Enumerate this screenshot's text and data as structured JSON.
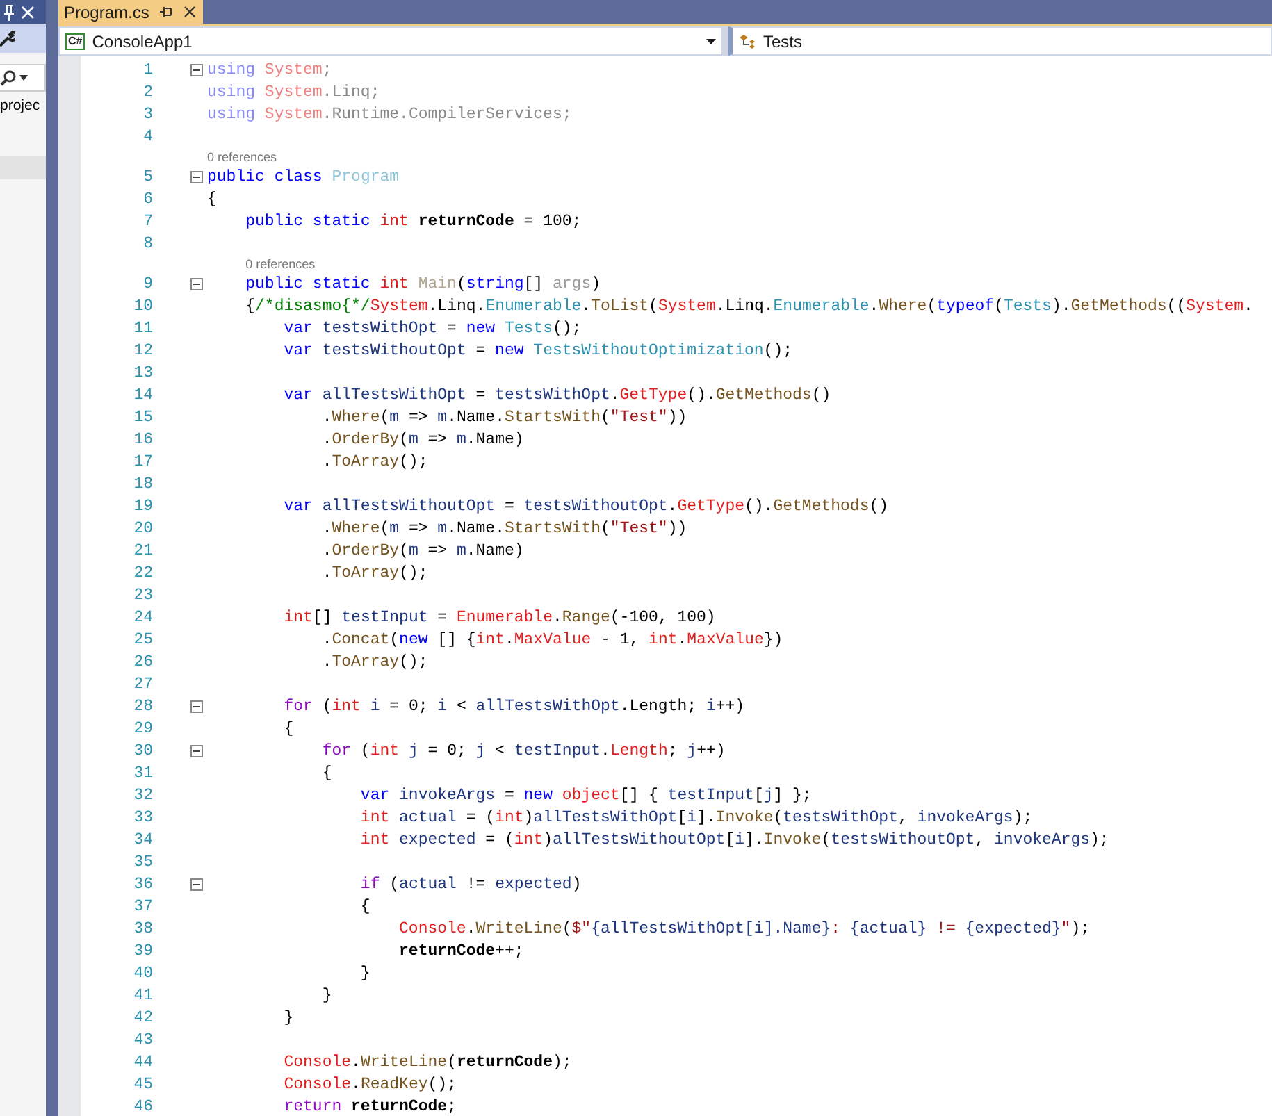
{
  "side_panel": {
    "label": "projec"
  },
  "tabs": [
    {
      "label": "Program.cs",
      "selected": true
    }
  ],
  "nav": {
    "project_badge": "C#",
    "project": "ConsoleApp1",
    "member": "Tests"
  },
  "lines": [
    {
      "kind": "code",
      "n": "1",
      "fold": true,
      "t": [
        {
          "kind": "u",
          "text": "using"
        },
        {
          "kind": "ns",
          "text": " System"
        },
        {
          "kind": "f",
          "text": ";"
        }
      ]
    },
    {
      "kind": "code",
      "n": "2",
      "fold": false,
      "t": [
        {
          "kind": "u",
          "text": "using"
        },
        {
          "kind": "ns",
          "text": " System"
        },
        {
          "kind": "f",
          "text": ".Linq;"
        }
      ]
    },
    {
      "kind": "code",
      "n": "3",
      "fold": false,
      "t": [
        {
          "kind": "u",
          "text": "using"
        },
        {
          "kind": "ns",
          "text": " System"
        },
        {
          "kind": "f",
          "text": ".Runtime.CompilerServices;"
        }
      ]
    },
    {
      "kind": "code",
      "n": "4",
      "fold": false
    },
    {
      "kind": "lens",
      "text": "0 references"
    },
    {
      "kind": "code",
      "n": "5",
      "fold": true,
      "t": [
        {
          "kind": "kw",
          "text": "public"
        },
        {
          "kind": "kw",
          "text": " class"
        },
        {
          "kind": "cf",
          "text": " Program"
        }
      ]
    },
    {
      "kind": "code",
      "n": "6",
      "fold": false,
      "t": [
        {
          "kind": "p",
          "text": "{"
        }
      ]
    },
    {
      "kind": "code",
      "n": "7",
      "fold": false,
      "t": [
        {
          "kind": "kw",
          "text": "    public"
        },
        {
          "kind": "kw",
          "text": " static"
        },
        {
          "kind": "ty",
          "text": " int"
        },
        {
          "kind": "fld",
          "text": " returnCode"
        },
        {
          "kind": "p",
          "text": " = 100;"
        }
      ]
    },
    {
      "kind": "code",
      "n": "8",
      "fold": false
    },
    {
      "kind": "lens",
      "text": "0 references"
    },
    {
      "kind": "code",
      "n": "9",
      "fold": true,
      "t": [
        {
          "kind": "kw",
          "text": "    public"
        },
        {
          "kind": "kw",
          "text": " static"
        },
        {
          "kind": "ty",
          "text": " int"
        },
        {
          "kind": "ff",
          "text": " Main"
        },
        {
          "kind": "p",
          "text": "("
        },
        {
          "kind": "kw",
          "text": "string"
        },
        {
          "kind": "p",
          "text": "[]"
        },
        {
          "kind": "un",
          "text": " args"
        },
        {
          "kind": "p",
          "text": ")"
        }
      ]
    },
    {
      "kind": "code",
      "n": "10",
      "fold": false,
      "t": [
        {
          "kind": "p",
          "text": "    {"
        },
        {
          "kind": "com",
          "text": "/*disasmo{*/"
        },
        {
          "kind": "ty",
          "text": "System"
        },
        {
          "kind": "p",
          "text": ".Linq."
        },
        {
          "kind": "cls",
          "text": "Enumerable"
        },
        {
          "kind": "p",
          "text": "."
        },
        {
          "kind": "fn",
          "text": "ToList"
        },
        {
          "kind": "p",
          "text": "("
        },
        {
          "kind": "ty",
          "text": "System"
        },
        {
          "kind": "p",
          "text": ".Linq."
        },
        {
          "kind": "cls",
          "text": "Enumerable"
        },
        {
          "kind": "p",
          "text": "."
        },
        {
          "kind": "fn",
          "text": "Where"
        },
        {
          "kind": "p",
          "text": "("
        },
        {
          "kind": "kw",
          "text": "typeof"
        },
        {
          "kind": "p",
          "text": "("
        },
        {
          "kind": "cls",
          "text": "Tests"
        },
        {
          "kind": "p",
          "text": ")."
        },
        {
          "kind": "fn",
          "text": "GetMethods"
        },
        {
          "kind": "p",
          "text": "(("
        },
        {
          "kind": "ty",
          "text": "System"
        },
        {
          "kind": "p",
          "text": "."
        }
      ]
    },
    {
      "kind": "code",
      "n": "11",
      "fold": false,
      "t": [
        {
          "kind": "kw",
          "text": "        var"
        },
        {
          "kind": "id",
          "text": " testsWithOpt"
        },
        {
          "kind": "p",
          "text": " ="
        },
        {
          "kind": "kw",
          "text": " new"
        },
        {
          "kind": "cls",
          "text": " Tests"
        },
        {
          "kind": "p",
          "text": "();"
        }
      ]
    },
    {
      "kind": "code",
      "n": "12",
      "fold": false,
      "t": [
        {
          "kind": "kw",
          "text": "        var"
        },
        {
          "kind": "id",
          "text": " testsWithoutOpt"
        },
        {
          "kind": "p",
          "text": " ="
        },
        {
          "kind": "kw",
          "text": " new"
        },
        {
          "kind": "cls",
          "text": " TestsWithoutOptimization"
        },
        {
          "kind": "p",
          "text": "();"
        }
      ]
    },
    {
      "kind": "code",
      "n": "13",
      "fold": false
    },
    {
      "kind": "code",
      "n": "14",
      "fold": false,
      "t": [
        {
          "kind": "kw",
          "text": "        var"
        },
        {
          "kind": "id",
          "text": " allTestsWithOpt"
        },
        {
          "kind": "p",
          "text": " ="
        },
        {
          "kind": "id",
          "text": " testsWithOpt"
        },
        {
          "kind": "p",
          "text": "."
        },
        {
          "kind": "ty",
          "text": "GetType"
        },
        {
          "kind": "p",
          "text": "()."
        },
        {
          "kind": "fn",
          "text": "GetMethods"
        },
        {
          "kind": "p",
          "text": "()"
        }
      ]
    },
    {
      "kind": "code",
      "n": "15",
      "fold": false,
      "t": [
        {
          "kind": "p",
          "text": "            ."
        },
        {
          "kind": "fn",
          "text": "Where"
        },
        {
          "kind": "p",
          "text": "("
        },
        {
          "kind": "id",
          "text": "m"
        },
        {
          "kind": "p",
          "text": " =>"
        },
        {
          "kind": "id",
          "text": " m"
        },
        {
          "kind": "p",
          "text": ".Name."
        },
        {
          "kind": "fn",
          "text": "StartsWith"
        },
        {
          "kind": "p",
          "text": "("
        },
        {
          "kind": "str",
          "text": "\"Test\""
        },
        {
          "kind": "p",
          "text": "))"
        }
      ]
    },
    {
      "kind": "code",
      "n": "16",
      "fold": false,
      "t": [
        {
          "kind": "p",
          "text": "            ."
        },
        {
          "kind": "fn",
          "text": "OrderBy"
        },
        {
          "kind": "p",
          "text": "("
        },
        {
          "kind": "id",
          "text": "m"
        },
        {
          "kind": "p",
          "text": " =>"
        },
        {
          "kind": "id",
          "text": " m"
        },
        {
          "kind": "p",
          "text": ".Name)"
        }
      ]
    },
    {
      "kind": "code",
      "n": "17",
      "fold": false,
      "t": [
        {
          "kind": "p",
          "text": "            ."
        },
        {
          "kind": "fn",
          "text": "ToArray"
        },
        {
          "kind": "p",
          "text": "();"
        }
      ]
    },
    {
      "kind": "code",
      "n": "18",
      "fold": false
    },
    {
      "kind": "code",
      "n": "19",
      "fold": false,
      "t": [
        {
          "kind": "kw",
          "text": "        var"
        },
        {
          "kind": "id",
          "text": " allTestsWithoutOpt"
        },
        {
          "kind": "p",
          "text": " ="
        },
        {
          "kind": "id",
          "text": " testsWithoutOpt"
        },
        {
          "kind": "p",
          "text": "."
        },
        {
          "kind": "ty",
          "text": "GetType"
        },
        {
          "kind": "p",
          "text": "()."
        },
        {
          "kind": "fn",
          "text": "GetMethods"
        },
        {
          "kind": "p",
          "text": "()"
        }
      ]
    },
    {
      "kind": "code",
      "n": "20",
      "fold": false,
      "t": [
        {
          "kind": "p",
          "text": "            ."
        },
        {
          "kind": "fn",
          "text": "Where"
        },
        {
          "kind": "p",
          "text": "("
        },
        {
          "kind": "id",
          "text": "m"
        },
        {
          "kind": "p",
          "text": " =>"
        },
        {
          "kind": "id",
          "text": " m"
        },
        {
          "kind": "p",
          "text": ".Name."
        },
        {
          "kind": "fn",
          "text": "StartsWith"
        },
        {
          "kind": "p",
          "text": "("
        },
        {
          "kind": "str",
          "text": "\"Test\""
        },
        {
          "kind": "p",
          "text": "))"
        }
      ]
    },
    {
      "kind": "code",
      "n": "21",
      "fold": false,
      "t": [
        {
          "kind": "p",
          "text": "            ."
        },
        {
          "kind": "fn",
          "text": "OrderBy"
        },
        {
          "kind": "p",
          "text": "("
        },
        {
          "kind": "id",
          "text": "m"
        },
        {
          "kind": "p",
          "text": " =>"
        },
        {
          "kind": "id",
          "text": " m"
        },
        {
          "kind": "p",
          "text": ".Name)"
        }
      ]
    },
    {
      "kind": "code",
      "n": "22",
      "fold": false,
      "t": [
        {
          "kind": "p",
          "text": "            ."
        },
        {
          "kind": "fn",
          "text": "ToArray"
        },
        {
          "kind": "p",
          "text": "();"
        }
      ]
    },
    {
      "kind": "code",
      "n": "23",
      "fold": false
    },
    {
      "kind": "code",
      "n": "24",
      "fold": false,
      "t": [
        {
          "kind": "ty",
          "text": "        int"
        },
        {
          "kind": "p",
          "text": "[]"
        },
        {
          "kind": "id",
          "text": " testInput"
        },
        {
          "kind": "p",
          "text": " ="
        },
        {
          "kind": "ty",
          "text": " Enumerable"
        },
        {
          "kind": "p",
          "text": "."
        },
        {
          "kind": "fn",
          "text": "Range"
        },
        {
          "kind": "p",
          "text": "(-100, 100)"
        }
      ]
    },
    {
      "kind": "code",
      "n": "25",
      "fold": false,
      "t": [
        {
          "kind": "p",
          "text": "            ."
        },
        {
          "kind": "fn",
          "text": "Concat"
        },
        {
          "kind": "p",
          "text": "("
        },
        {
          "kind": "kw",
          "text": "new"
        },
        {
          "kind": "p",
          "text": " [] {"
        },
        {
          "kind": "ty",
          "text": "int"
        },
        {
          "kind": "p",
          "text": "."
        },
        {
          "kind": "ty",
          "text": "MaxValue"
        },
        {
          "kind": "p",
          "text": " - 1,"
        },
        {
          "kind": "ty",
          "text": " int"
        },
        {
          "kind": "p",
          "text": "."
        },
        {
          "kind": "ty",
          "text": "MaxValue"
        },
        {
          "kind": "p",
          "text": "})"
        }
      ]
    },
    {
      "kind": "code",
      "n": "26",
      "fold": false,
      "t": [
        {
          "kind": "p",
          "text": "            ."
        },
        {
          "kind": "fn",
          "text": "ToArray"
        },
        {
          "kind": "p",
          "text": "();"
        }
      ]
    },
    {
      "kind": "code",
      "n": "27",
      "fold": false
    },
    {
      "kind": "code",
      "n": "28",
      "fold": true,
      "t": [
        {
          "kind": "ctl",
          "text": "        for"
        },
        {
          "kind": "p",
          "text": " ("
        },
        {
          "kind": "ty",
          "text": "int"
        },
        {
          "kind": "id",
          "text": " i"
        },
        {
          "kind": "p",
          "text": " = 0;"
        },
        {
          "kind": "id",
          "text": " i"
        },
        {
          "kind": "p",
          "text": " <"
        },
        {
          "kind": "id",
          "text": " allTestsWithOpt"
        },
        {
          "kind": "p",
          "text": ".Length;"
        },
        {
          "kind": "id",
          "text": " i"
        },
        {
          "kind": "p",
          "text": "++)"
        }
      ]
    },
    {
      "kind": "code",
      "n": "29",
      "fold": false,
      "t": [
        {
          "kind": "p",
          "text": "        {"
        }
      ]
    },
    {
      "kind": "code",
      "n": "30",
      "fold": true,
      "t": [
        {
          "kind": "ctl",
          "text": "            for"
        },
        {
          "kind": "p",
          "text": " ("
        },
        {
          "kind": "ty",
          "text": "int"
        },
        {
          "kind": "id",
          "text": " j"
        },
        {
          "kind": "p",
          "text": " = 0;"
        },
        {
          "kind": "id",
          "text": " j"
        },
        {
          "kind": "p",
          "text": " <"
        },
        {
          "kind": "id",
          "text": " testInput"
        },
        {
          "kind": "p",
          "text": "."
        },
        {
          "kind": "ty",
          "text": "Length"
        },
        {
          "kind": "p",
          "text": ";"
        },
        {
          "kind": "id",
          "text": " j"
        },
        {
          "kind": "p",
          "text": "++)"
        }
      ]
    },
    {
      "kind": "code",
      "n": "31",
      "fold": false,
      "t": [
        {
          "kind": "p",
          "text": "            {"
        }
      ]
    },
    {
      "kind": "code",
      "n": "32",
      "fold": false,
      "t": [
        {
          "kind": "kw",
          "text": "                var"
        },
        {
          "kind": "id",
          "text": " invokeArgs"
        },
        {
          "kind": "p",
          "text": " ="
        },
        {
          "kind": "kw",
          "text": " new"
        },
        {
          "kind": "ty",
          "text": " object"
        },
        {
          "kind": "p",
          "text": "[] {"
        },
        {
          "kind": "id",
          "text": " testInput"
        },
        {
          "kind": "p",
          "text": "["
        },
        {
          "kind": "id",
          "text": "j"
        },
        {
          "kind": "p",
          "text": "] };"
        }
      ]
    },
    {
      "kind": "code",
      "n": "33",
      "fold": false,
      "t": [
        {
          "kind": "ty",
          "text": "                int"
        },
        {
          "kind": "id",
          "text": " actual"
        },
        {
          "kind": "p",
          "text": " = ("
        },
        {
          "kind": "ty",
          "text": "int"
        },
        {
          "kind": "p",
          "text": ")"
        },
        {
          "kind": "id",
          "text": "allTestsWithOpt"
        },
        {
          "kind": "p",
          "text": "["
        },
        {
          "kind": "id",
          "text": "i"
        },
        {
          "kind": "p",
          "text": "]."
        },
        {
          "kind": "fn",
          "text": "Invoke"
        },
        {
          "kind": "p",
          "text": "("
        },
        {
          "kind": "id",
          "text": "testsWithOpt"
        },
        {
          "kind": "p",
          "text": ","
        },
        {
          "kind": "id",
          "text": " invokeArgs"
        },
        {
          "kind": "p",
          "text": ");"
        }
      ]
    },
    {
      "kind": "code",
      "n": "34",
      "fold": false,
      "t": [
        {
          "kind": "ty",
          "text": "                int"
        },
        {
          "kind": "id",
          "text": " expected"
        },
        {
          "kind": "p",
          "text": " = ("
        },
        {
          "kind": "ty",
          "text": "int"
        },
        {
          "kind": "p",
          "text": ")"
        },
        {
          "kind": "id",
          "text": "allTestsWithoutOpt"
        },
        {
          "kind": "p",
          "text": "["
        },
        {
          "kind": "id",
          "text": "i"
        },
        {
          "kind": "p",
          "text": "]."
        },
        {
          "kind": "fn",
          "text": "Invoke"
        },
        {
          "kind": "p",
          "text": "("
        },
        {
          "kind": "id",
          "text": "testsWithoutOpt"
        },
        {
          "kind": "p",
          "text": ","
        },
        {
          "kind": "id",
          "text": " invokeArgs"
        },
        {
          "kind": "p",
          "text": ");"
        }
      ]
    },
    {
      "kind": "code",
      "n": "35",
      "fold": false
    },
    {
      "kind": "code",
      "n": "36",
      "fold": true,
      "t": [
        {
          "kind": "ctl",
          "text": "                if"
        },
        {
          "kind": "p",
          "text": " ("
        },
        {
          "kind": "id",
          "text": "actual"
        },
        {
          "kind": "p",
          "text": " !="
        },
        {
          "kind": "id",
          "text": " expected"
        },
        {
          "kind": "p",
          "text": ")"
        }
      ]
    },
    {
      "kind": "code",
      "n": "37",
      "fold": false,
      "t": [
        {
          "kind": "p",
          "text": "                {"
        }
      ]
    },
    {
      "kind": "code",
      "n": "38",
      "fold": false,
      "t": [
        {
          "kind": "ty",
          "text": "                    Console"
        },
        {
          "kind": "p",
          "text": "."
        },
        {
          "kind": "fn",
          "text": "WriteLine"
        },
        {
          "kind": "p",
          "text": "("
        },
        {
          "kind": "str",
          "text": "$\""
        },
        {
          "kind": "id",
          "text": "{allTestsWithOpt[i].Name}"
        },
        {
          "kind": "str",
          "text": ":"
        },
        {
          "kind": "id",
          "text": " {actual}"
        },
        {
          "kind": "str",
          "text": " !="
        },
        {
          "kind": "id",
          "text": " {expected}"
        },
        {
          "kind": "str",
          "text": "\""
        },
        {
          "kind": "p",
          "text": ");"
        }
      ]
    },
    {
      "kind": "code",
      "n": "39",
      "fold": false,
      "t": [
        {
          "kind": "fld",
          "text": "                    returnCode"
        },
        {
          "kind": "p",
          "text": "++;"
        }
      ]
    },
    {
      "kind": "code",
      "n": "40",
      "fold": false,
      "t": [
        {
          "kind": "p",
          "text": "                }"
        }
      ]
    },
    {
      "kind": "code",
      "n": "41",
      "fold": false,
      "t": [
        {
          "kind": "p",
          "text": "            }"
        }
      ]
    },
    {
      "kind": "code",
      "n": "42",
      "fold": false,
      "t": [
        {
          "kind": "p",
          "text": "        }"
        }
      ]
    },
    {
      "kind": "code",
      "n": "43",
      "fold": false
    },
    {
      "kind": "code",
      "n": "44",
      "fold": false,
      "t": [
        {
          "kind": "ty",
          "text": "        Console"
        },
        {
          "kind": "p",
          "text": "."
        },
        {
          "kind": "fn",
          "text": "WriteLine"
        },
        {
          "kind": "p",
          "text": "("
        },
        {
          "kind": "fld",
          "text": "returnCode"
        },
        {
          "kind": "p",
          "text": ");"
        }
      ]
    },
    {
      "kind": "code",
      "n": "45",
      "fold": false,
      "t": [
        {
          "kind": "ty",
          "text": "        Console"
        },
        {
          "kind": "p",
          "text": "."
        },
        {
          "kind": "fn",
          "text": "ReadKey"
        },
        {
          "kind": "p",
          "text": "();"
        }
      ]
    },
    {
      "kind": "code",
      "n": "46",
      "fold": false,
      "t": [
        {
          "kind": "ctl",
          "text": "        return"
        },
        {
          "kind": "fld",
          "text": " returnCode"
        },
        {
          "kind": "p",
          "text": ";"
        }
      ]
    }
  ]
}
